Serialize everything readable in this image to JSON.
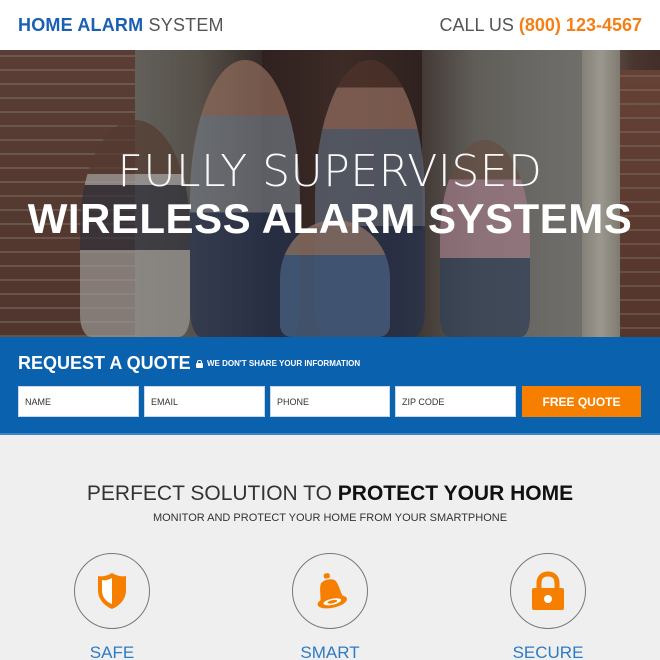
{
  "header": {
    "logo_bold": "HOME ALARM",
    "logo_light": "SYSTEM",
    "call_label": "CALL US",
    "phone_number": "(800) 123-4567"
  },
  "hero": {
    "headline_line1": "FULLY SUPERVISED",
    "headline_line2": "WIRELESS ALARM SYSTEMS",
    "background_image": "family-sitting-on-porch-photo"
  },
  "quote_form": {
    "title": "REQUEST A QUOTE",
    "privacy_note": "WE DON'T SHARE YOUR INFORMATION",
    "fields": [
      {
        "name": "name",
        "placeholder": "NAME",
        "value": ""
      },
      {
        "name": "email",
        "placeholder": "EMAIL",
        "value": ""
      },
      {
        "name": "phone",
        "placeholder": "PHONE",
        "value": ""
      },
      {
        "name": "zip",
        "placeholder": "ZIP CODE",
        "value": ""
      }
    ],
    "submit_label": "FREE QUOTE"
  },
  "features": {
    "title_light": "PERFECT SOLUTION TO",
    "title_bold": "PROTECT YOUR HOME",
    "subtitle": "MONITOR AND PROTECT YOUR HOME FROM YOUR SMARTPHONE",
    "items": [
      {
        "label": "SAFE",
        "icon": "shield-icon"
      },
      {
        "label": "SMART",
        "icon": "bell-icon"
      },
      {
        "label": "SECURE",
        "icon": "lock-icon"
      }
    ]
  },
  "colors": {
    "brand_blue": "#0a61ae",
    "accent_orange": "#f77f00",
    "feature_label_blue": "#2d7bc4"
  }
}
